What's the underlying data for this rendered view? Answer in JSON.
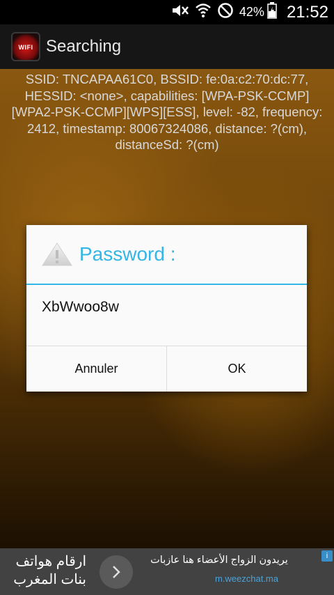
{
  "status_bar": {
    "battery": "42%",
    "time": "21:52",
    "icons": [
      "mute-icon",
      "wifi-icon",
      "blocked-icon",
      "battery-icon"
    ]
  },
  "action_bar": {
    "app_icon_text": "WIFI",
    "title": "Searching"
  },
  "wifi_info": {
    "text": "SSID: TNCAPAA61C0, BSSID: fe:0a:c2:70:dc:77, HESSID: <none>, capabilities: [WPA-PSK-CCMP][WPA2-PSK-CCMP][WPS][ESS], level: -82, frequency: 2412, timestamp: 80067324086, distance: ?(cm), distanceSd: ?(cm)"
  },
  "dialog": {
    "title": "Password :",
    "message": "XbWwoo8w",
    "negative_label": "Annuler",
    "positive_label": "OK",
    "accent_color": "#33b5e5"
  },
  "ad": {
    "left_text_line1": "ارقام هواتف",
    "left_text_line2": "بنات المغرب",
    "right_text": "يريدون الزواج الأعضاء هنا عازبات",
    "url": "m.weezchat.ma",
    "info_icon": "i"
  }
}
